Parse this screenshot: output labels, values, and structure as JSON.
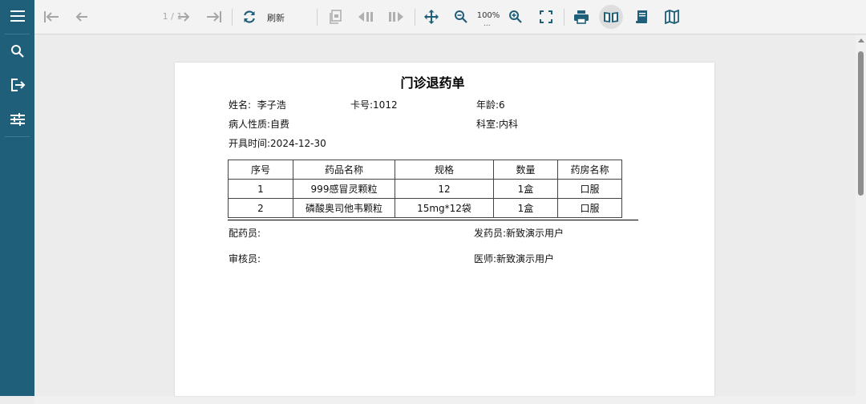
{
  "toolbar": {
    "page_indicator": "1 / 1",
    "refresh_label": "刷新",
    "zoom_level": "100%",
    "zoom_menu": "..."
  },
  "report": {
    "title": "门诊退药单",
    "name_label": "姓名:",
    "name_value": "李子浩",
    "card_label": "卡号:",
    "card_value": "1012",
    "age_label": "年龄:",
    "age_value": "6",
    "nature_label": "病人性质:",
    "nature_value": "自费",
    "dept_label": "科室:",
    "dept_value": "内科",
    "date_label": "开具时间:",
    "date_value": "2024-12-30",
    "columns": [
      "序号",
      "药品名称",
      "规格",
      "数量",
      "药房名称"
    ],
    "rows": [
      [
        "1",
        "999感冒灵颗粒",
        "12",
        "1盒",
        "口服"
      ],
      [
        "2",
        "磷酸奥司他韦颗粒",
        "15mg*12袋",
        "1盒",
        "口服"
      ]
    ],
    "dispenser_label": "配药员:",
    "dispenser_value": "",
    "issuer_label": "发药员:",
    "issuer_value": "新致演示用户",
    "auditor_label": "审核员:",
    "auditor_value": "",
    "doctor_label": "医师:",
    "doctor_value": "新致演示用户"
  }
}
